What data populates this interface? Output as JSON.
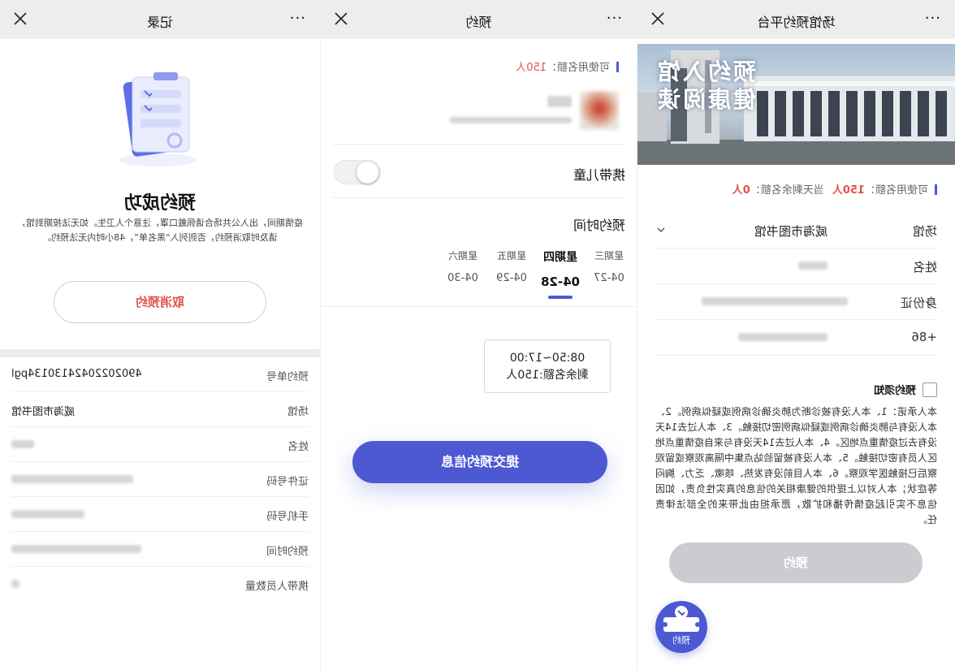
{
  "record": {
    "title": "记录",
    "more": "···",
    "success_title": "预约成功",
    "notice": "疫情期间，出入公共场合请佩戴口罩，注意个人卫生。如无法按期到馆，请及时取消预约，否则列入“黑名单”，48小时内无法预约。",
    "cancel_label": "取消预约",
    "rows": [
      {
        "label": "预约单号",
        "value": "49020220424130134pgl"
      },
      {
        "label": "场馆",
        "value": "威海市图书馆"
      },
      {
        "label": "姓名",
        "value": ""
      },
      {
        "label": "证件号码",
        "value": ""
      },
      {
        "label": "手机号码",
        "value": ""
      },
      {
        "label": "预约时间",
        "value": ""
      },
      {
        "label": "携带人员数量",
        "value": ""
      }
    ]
  },
  "booking": {
    "title": "预约",
    "more": "···",
    "quota_label": "可使用名额：",
    "quota_value": "150人",
    "child_label": "携带儿童",
    "time_label": "预约时间",
    "days": [
      {
        "week": "星期三",
        "date": "04-27",
        "active": false
      },
      {
        "week": "星期四",
        "date": "04-28",
        "active": true
      },
      {
        "week": "星期五",
        "date": "04-29",
        "active": false
      },
      {
        "week": "星期六",
        "date": "04-30",
        "active": false
      }
    ],
    "slot_time": "08:50~17:00",
    "slot_remain": "剩余名额:150人",
    "submit_label": "提交预约信息"
  },
  "platform": {
    "title": "场馆预约平台",
    "more": "···",
    "banner_line1": "预约入馆",
    "banner_line2": "健康阅读",
    "quota_label": "可使用名额：",
    "quota_value": "150人",
    "remain_label": "当天剩余名额：",
    "remain_value": "0人",
    "venue_label": "场馆",
    "venue_value": "威海市图书馆",
    "name_label": "姓名",
    "id_label": "身份证",
    "phone_label": "+86",
    "agree_label": "预约须知",
    "terms": "本人承诺：1、本人没有被诊断为肺炎确诊病例或疑似病例。2、本人没有与肺炎确诊病例或疑似病例密切接触。3、本人过去14天没有去过疫情重点地区。4、本人过去14天没有与来自疫情重点地区人员有密切接触。5、本人没有被留验站点集中隔离观察或留观察后已接触医学观察。6、本人目前没有发热、咳嗽、乏力、胸闷等症状；本人对以上提供的健康相关的信息的真实性负责，如因信息不实引起疫情传播和扩散，愿承担由此带来的全部法律责任。",
    "reserve_label": "预约",
    "fab_label": "预约"
  },
  "colors": {
    "accent": "#4c59d2",
    "danger": "#e0534a",
    "navbar": "#ededed",
    "disabled": "#cbccd2"
  }
}
